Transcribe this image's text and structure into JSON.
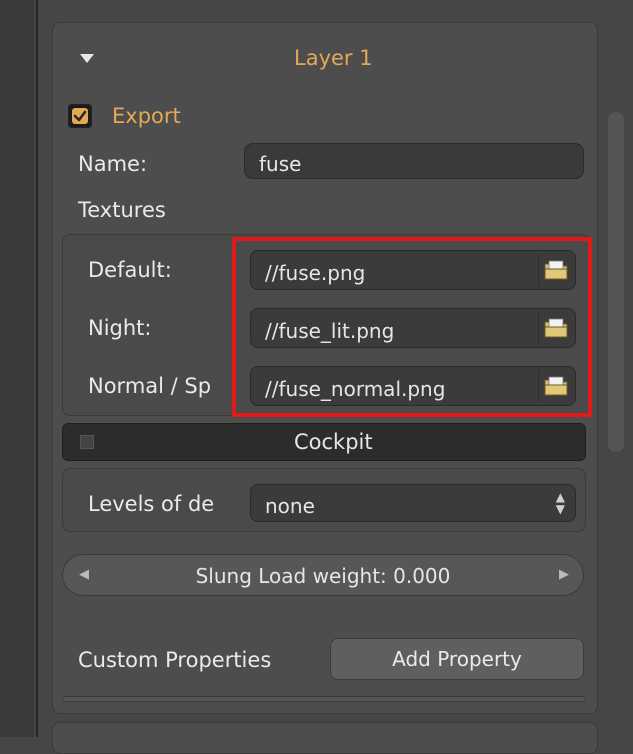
{
  "layer": {
    "title": "Layer 1",
    "export_label": "Export",
    "export_checked": true,
    "name_label": "Name:",
    "name_value": "fuse",
    "textures_label": "Textures"
  },
  "textures": {
    "default_label": "Default:",
    "default_value": "//fuse.png",
    "night_label": "Night:",
    "night_value": "//fuse_lit.png",
    "normal_label": "Normal / Sp",
    "normal_value": "//fuse_normal.png"
  },
  "cockpit": {
    "label": "Cockpit",
    "checked": false
  },
  "lod": {
    "label": "Levels of de",
    "value": "none"
  },
  "slung": {
    "label": "Slung Load weight: 0.000"
  },
  "custom": {
    "label": "Custom Properties",
    "add_button": "Add Property"
  },
  "colors": {
    "accent": "#e3a955",
    "highlight": "#e01919",
    "panel": "#4d4d4d"
  },
  "icons": {
    "collapse": "triangle-down-icon",
    "file_browse": "folder-icon"
  }
}
